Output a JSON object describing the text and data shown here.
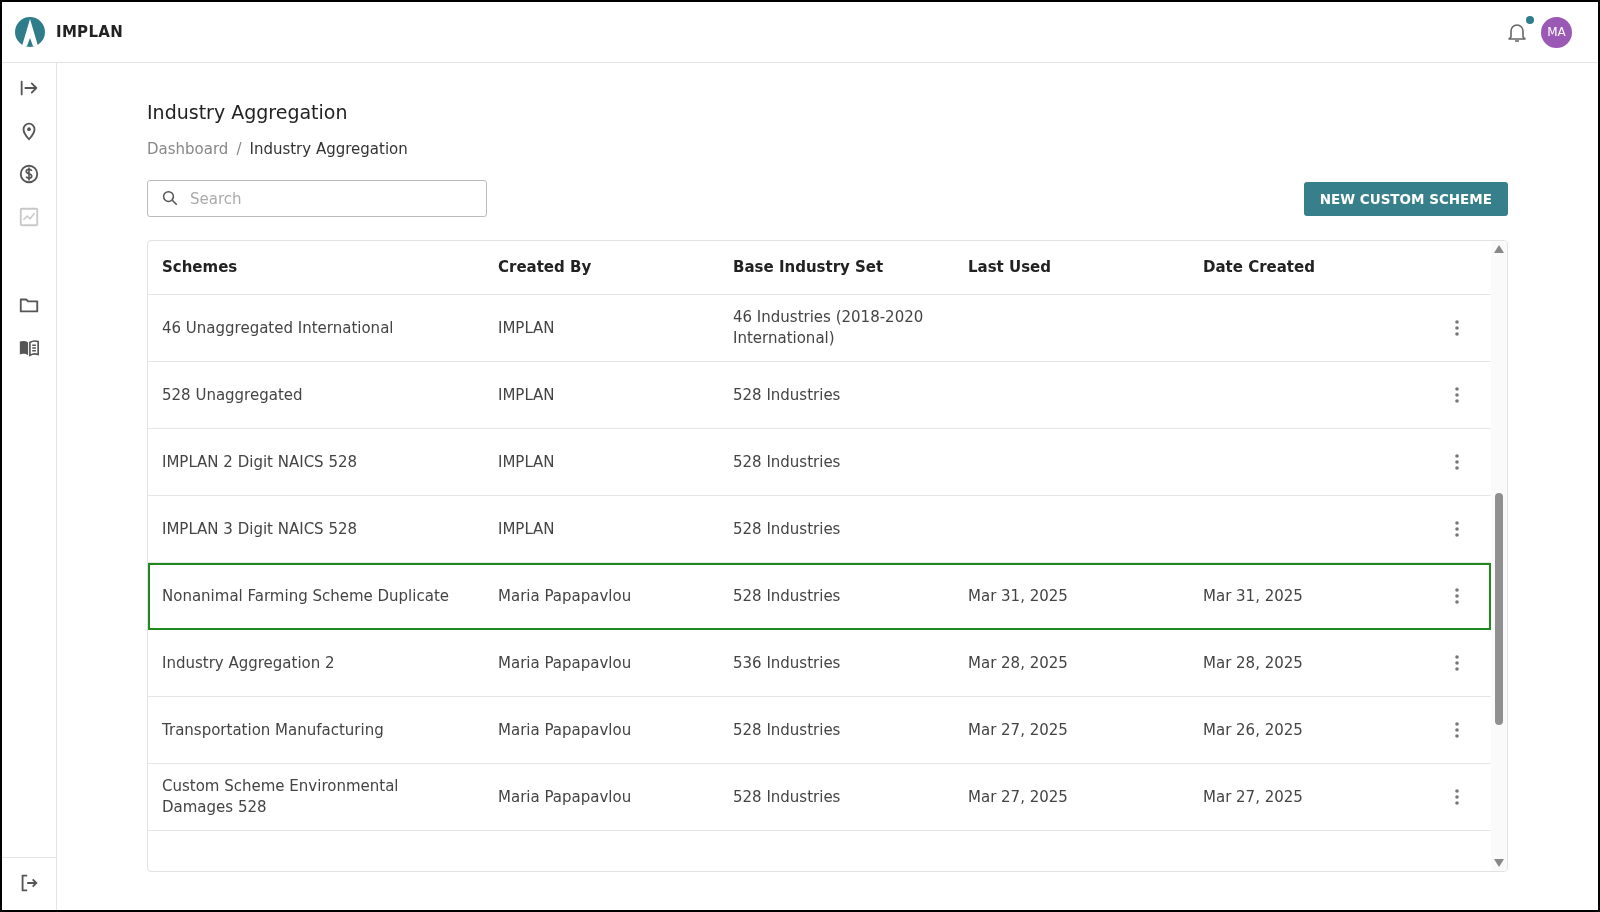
{
  "header": {
    "brand": "IMPLAN",
    "notifications": {
      "unread": true
    },
    "avatar": {
      "initials": "MA",
      "color": "#9b59b6"
    }
  },
  "sidebar": {
    "items": [
      {
        "kind": "expand",
        "disabled": false
      },
      {
        "kind": "location",
        "disabled": false
      },
      {
        "kind": "money",
        "disabled": false
      },
      {
        "kind": "chart",
        "disabled": true
      },
      {
        "kind": "folder",
        "disabled": false
      },
      {
        "kind": "book",
        "disabled": false
      }
    ],
    "bottom_item": {
      "kind": "logout",
      "disabled": false
    }
  },
  "page": {
    "title": "Industry Aggregation",
    "breadcrumb": [
      {
        "label": "Dashboard",
        "current": false
      },
      {
        "label": "Industry Aggregation",
        "current": true
      }
    ],
    "breadcrumb_separator": "/",
    "search": {
      "placeholder": "Search"
    },
    "new_button": "NEW CUSTOM SCHEME"
  },
  "table": {
    "columns": [
      "Schemes",
      "Created By",
      "Base Industry Set",
      "Last Used",
      "Date Created"
    ],
    "rows": [
      {
        "cells": [
          "46 Unaggregated International",
          "IMPLAN",
          "46 Industries (2018-2020 International)",
          "",
          ""
        ],
        "selected": false
      },
      {
        "cells": [
          "528 Unaggregated",
          "IMPLAN",
          "528 Industries",
          "",
          ""
        ],
        "selected": false
      },
      {
        "cells": [
          "IMPLAN 2 Digit NAICS 528",
          "IMPLAN",
          "528 Industries",
          "",
          ""
        ],
        "selected": false
      },
      {
        "cells": [
          "IMPLAN 3 Digit NAICS 528",
          "IMPLAN",
          "528 Industries",
          "",
          ""
        ],
        "selected": false
      },
      {
        "cells": [
          "Nonanimal Farming Scheme Duplicate",
          "Maria Papapavlou",
          "528 Industries",
          "Mar 31, 2025",
          "Mar 31, 2025"
        ],
        "selected": true
      },
      {
        "cells": [
          "Industry Aggregation 2",
          "Maria Papapavlou",
          "536 Industries",
          "Mar 28, 2025",
          "Mar 28, 2025"
        ],
        "selected": false
      },
      {
        "cells": [
          "Transportation Manufacturing",
          "Maria Papapavlou",
          "528 Industries",
          "Mar 27, 2025",
          "Mar 26, 2025"
        ],
        "selected": false
      },
      {
        "cells": [
          "Custom Scheme Environmental Damages 528",
          "Maria Papapavlou",
          "528 Industries",
          "Mar 27, 2025",
          "Mar 27, 2025"
        ],
        "selected": false
      }
    ]
  }
}
